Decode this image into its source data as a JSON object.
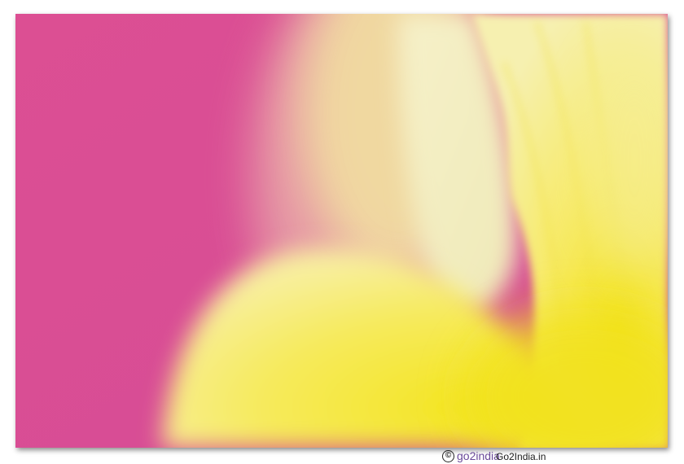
{
  "watermark": {
    "copyright_symbol": "©",
    "ghost_text": "go2india",
    "text": "Go2India.in"
  },
  "colors": {
    "background_pink": "#d94f95",
    "petal_yellow": "#f6e95a",
    "petal_cream": "#f3efc4",
    "frame_bg": "#ffffff"
  }
}
